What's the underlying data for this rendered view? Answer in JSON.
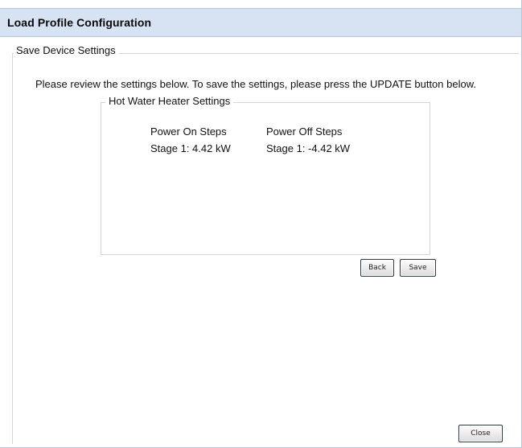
{
  "dialog": {
    "title": "Load Profile Configuration"
  },
  "save_settings": {
    "legend": "Save Device Settings",
    "instructions": "Please review the settings below. To save the settings, please press the UPDATE button below.",
    "device": {
      "legend": "Hot Water Heater Settings",
      "power_on": {
        "header": "Power On Steps",
        "steps": [
          "Stage 1: 4.42 kW"
        ]
      },
      "power_off": {
        "header": "Power Off Steps",
        "steps": [
          "Stage 1: -4.42 kW"
        ]
      }
    }
  },
  "buttons": {
    "back": "Back",
    "save": "Save",
    "close": "Close"
  }
}
